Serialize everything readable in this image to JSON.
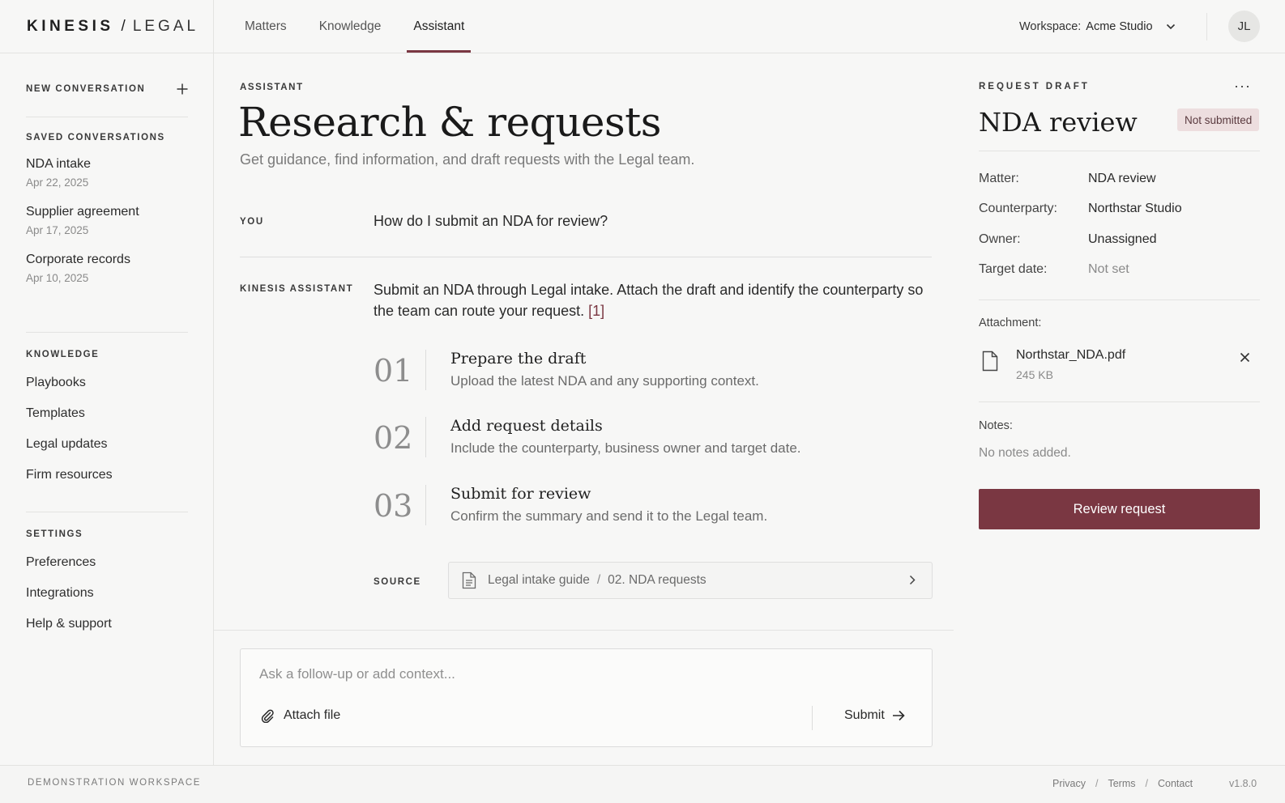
{
  "brand": {
    "primary": "KINESIS",
    "separator": "/",
    "secondary": "LEGAL"
  },
  "nav": {
    "tabs": [
      {
        "label": "Matters"
      },
      {
        "label": "Knowledge"
      },
      {
        "label": "Assistant",
        "active": true
      }
    ]
  },
  "workspace": {
    "label": "Workspace:",
    "value": "Acme Studio",
    "icon": "chevron-down-icon"
  },
  "user": {
    "initials": "JL"
  },
  "sidebar": {
    "new_conversation": "NEW CONVERSATION",
    "saved_heading": "SAVED CONVERSATIONS",
    "saved": [
      {
        "title": "NDA intake",
        "date": "Apr 22, 2025"
      },
      {
        "title": "Supplier agreement",
        "date": "Apr 17, 2025"
      },
      {
        "title": "Corporate records",
        "date": "Apr 10, 2025"
      }
    ],
    "knowledge_heading": "KNOWLEDGE",
    "knowledge": [
      "Playbooks",
      "Templates",
      "Legal updates",
      "Firm resources"
    ],
    "settings_heading": "SETTINGS",
    "settings": [
      "Preferences",
      "Integrations",
      "Help & support"
    ]
  },
  "main": {
    "eyebrow": "ASSISTANT",
    "title": "Research & requests",
    "subtitle": "Get guidance, find information, and draft requests with the Legal team.",
    "you_label": "YOU",
    "question": "How do I submit an NDA for review?",
    "assistant_label": "KINESIS ASSISTANT",
    "answer": "Submit an NDA through Legal intake. Attach the draft and identify the counterparty so the team can route your request.",
    "citation": "[1]",
    "steps": [
      {
        "num": "01",
        "title": "Prepare the draft",
        "desc": "Upload the latest NDA and any supporting context."
      },
      {
        "num": "02",
        "title": "Add request details",
        "desc": "Include the counterparty, business owner and target date."
      },
      {
        "num": "03",
        "title": "Submit for review",
        "desc": "Confirm the summary and send it to the Legal team."
      }
    ],
    "source_label": "SOURCE",
    "source": {
      "doc": "Legal intake guide",
      "separator": "/",
      "section": "02. NDA requests"
    }
  },
  "composer": {
    "placeholder": "Ask a follow-up or add context...",
    "attach_label": "Attach file",
    "submit_label": "Submit"
  },
  "panel": {
    "eyebrow": "REQUEST DRAFT",
    "title": "NDA review",
    "status": "Not submitted",
    "fields": [
      {
        "key": "Matter:",
        "value": "NDA review"
      },
      {
        "key": "Counterparty:",
        "value": "Northstar Studio"
      },
      {
        "key": "Owner:",
        "value": "Unassigned"
      },
      {
        "key": "Target date:",
        "value": "Not set"
      }
    ],
    "attachment_label": "Attachment:",
    "attachment": {
      "name": "Northstar_NDA.pdf",
      "size": "245 KB"
    },
    "notes_label": "Notes:",
    "notes_value": "No notes added.",
    "review_button": "Review request"
  },
  "footer": {
    "left": "DEMONSTRATION WORKSPACE",
    "links": [
      "Privacy",
      "Terms",
      "Contact"
    ],
    "separator": "/",
    "version": "v1.8.0"
  },
  "colors": {
    "accent": "#7a3742",
    "badge_bg": "#eddedf",
    "background": "#f7f7f6"
  }
}
